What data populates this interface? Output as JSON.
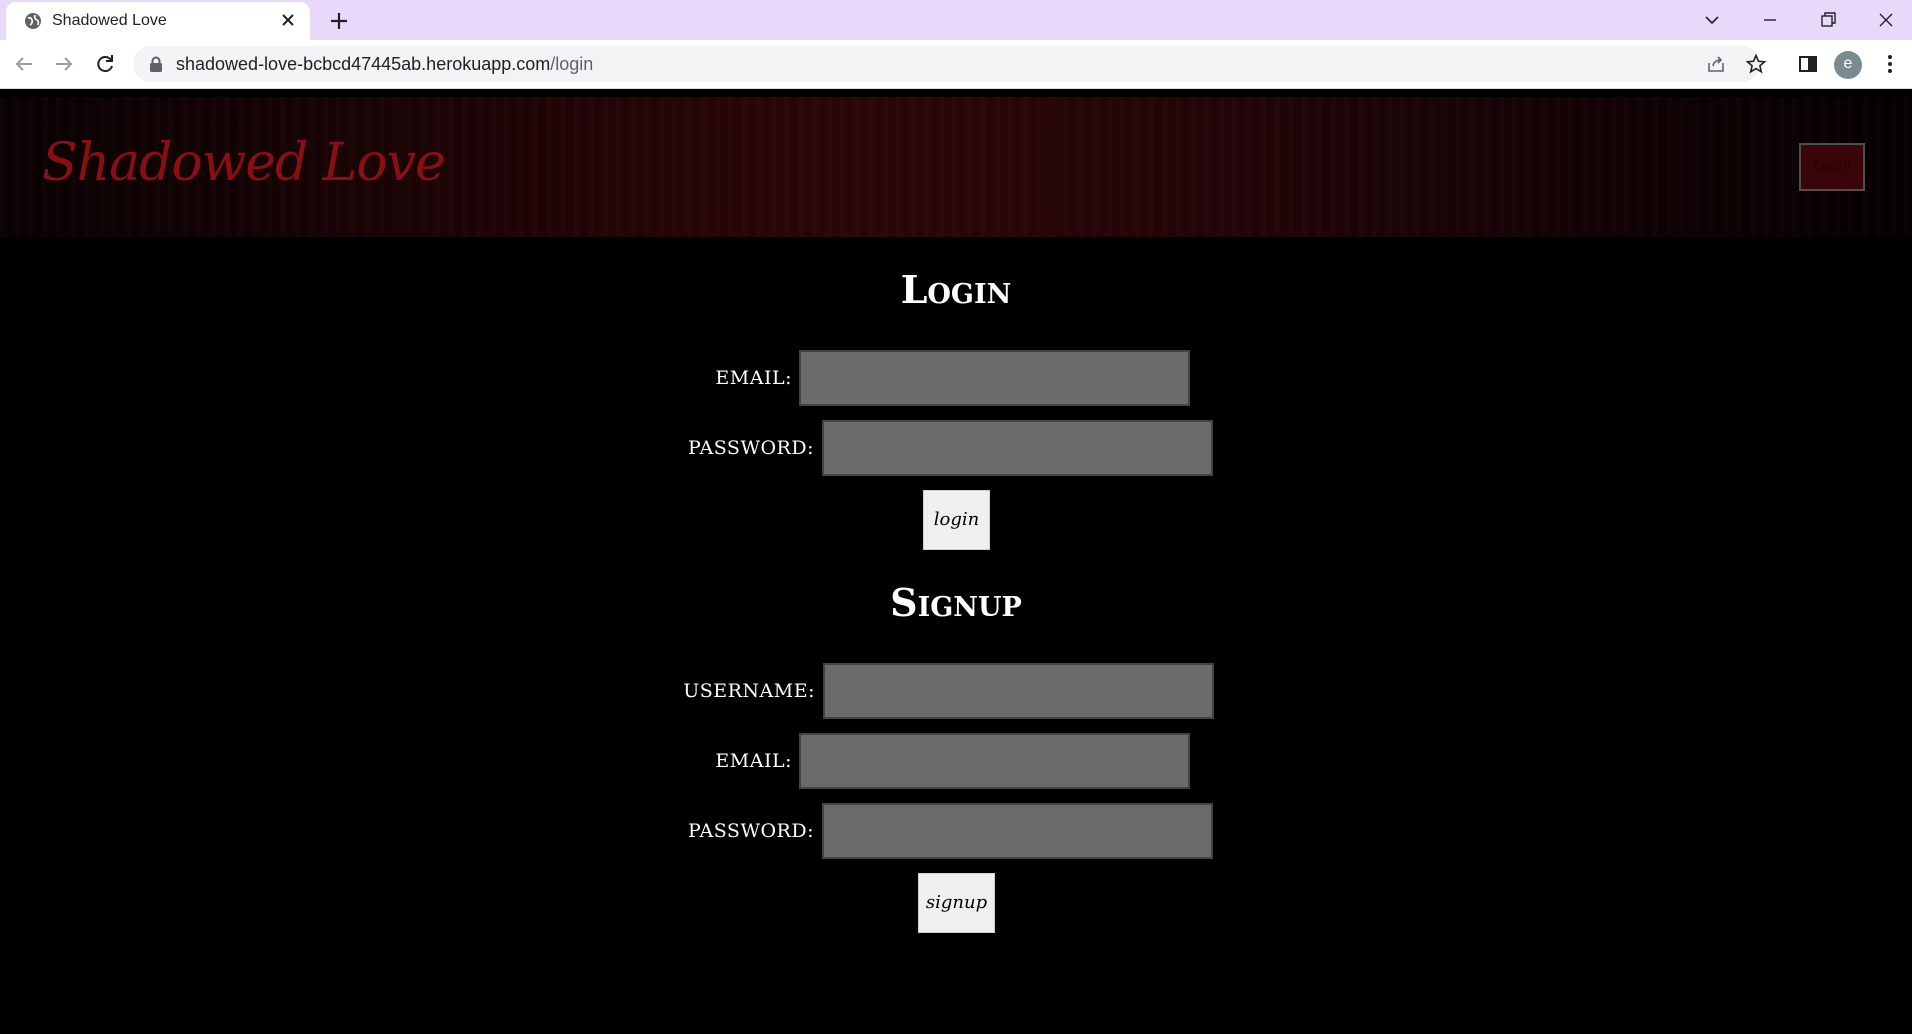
{
  "browser": {
    "tab_title": "Shadowed Love",
    "url_host": "shadowed-love-bcbcd47445ab.herokuapp.com",
    "url_path": "/login",
    "profile_initial": "e"
  },
  "header": {
    "logo": "Shadowed Love",
    "nav_button_label": "Login"
  },
  "login": {
    "title": "Login",
    "email_label": "EMAIL:",
    "password_label": "PASSWORD:",
    "submit_label": "login"
  },
  "signup": {
    "title": "Signup",
    "username_label": "USERNAME:",
    "email_label": "EMAIL:",
    "password_label": "PASSWORD:",
    "submit_label": "signup"
  },
  "colors": {
    "tabbar": "#e8d9fb",
    "header_accent": "#2b0609",
    "logo": "#8a0f14",
    "input_bg": "#6b6b6b",
    "page_bg": "#000000"
  }
}
